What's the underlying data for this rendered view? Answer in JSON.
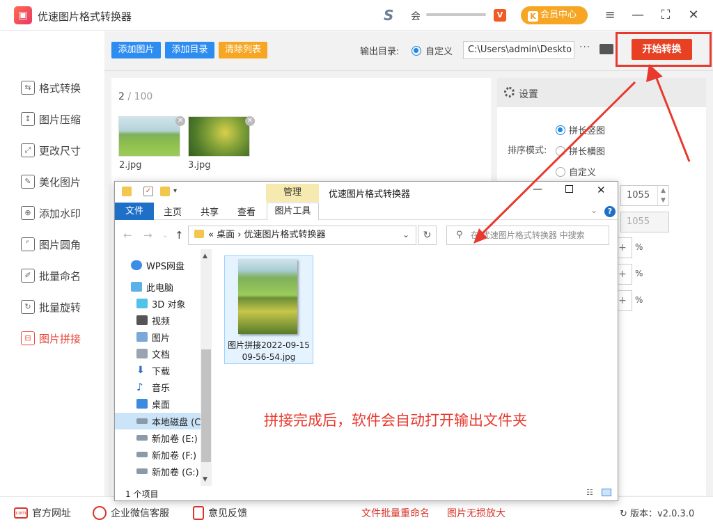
{
  "app": {
    "title": "优速图片格式转换器",
    "user_name": "会",
    "member_label": "会员中心",
    "member_k": "K",
    "vip_badge": "V"
  },
  "window_controls": {
    "menu": "≡",
    "minimize": "—",
    "maximize": "⛶",
    "close": "✕"
  },
  "sidebar": {
    "items": [
      {
        "label": "格式转换",
        "icon": "format-convert-icon"
      },
      {
        "label": "图片压缩",
        "icon": "compress-icon"
      },
      {
        "label": "更改尺寸",
        "icon": "resize-icon"
      },
      {
        "label": "美化图片",
        "icon": "beautify-icon"
      },
      {
        "label": "添加水印",
        "icon": "watermark-icon"
      },
      {
        "label": "图片圆角",
        "icon": "round-corner-icon"
      },
      {
        "label": "批量命名",
        "icon": "rename-icon"
      },
      {
        "label": "批量旋转",
        "icon": "rotate-icon"
      },
      {
        "label": "图片拼接",
        "icon": "stitch-icon",
        "active": true
      }
    ]
  },
  "toolbar": {
    "add_image": "添加图片",
    "add_folder": "添加目录",
    "clear_list": "清除列表",
    "output_label": "输出目录:",
    "custom_label": "自定义",
    "output_path": "C:\\Users\\admin\\Deskto",
    "more": "···",
    "start": "开始转换"
  },
  "images": {
    "count": "2",
    "total": "/ 100",
    "files": [
      "2.jpg",
      "3.jpg"
    ]
  },
  "settings": {
    "title": "设置",
    "sort_label": "排序模式:",
    "options": [
      "拼长竖图",
      "拼长横图",
      "自定义"
    ],
    "width_value": "1055",
    "height_value": "1055",
    "plus": "+",
    "percent": "%"
  },
  "explorer": {
    "manage_tab": "管理",
    "title": "优速图片格式转换器",
    "tabs": [
      "文件",
      "主页",
      "共享",
      "查看",
      "图片工具"
    ],
    "address": "«  桌面  ›  优速图片格式转换器",
    "search_placeholder": "在 优速图片格式转换器 中搜索",
    "tree": [
      "WPS网盘",
      "此电脑",
      "3D 对象",
      "视频",
      "图片",
      "文档",
      "下载",
      "音乐",
      "桌面",
      "本地磁盘 (C:)",
      "新加卷 (E:)",
      "新加卷 (F:)",
      "新加卷 (G:)"
    ],
    "file_name": "图片拼接2022-09-15 09-56-54.jpg",
    "status": "1 个项目"
  },
  "annotation": "拼接完成后，软件会自动打开输出文件夹",
  "footer": {
    "website": "官方网址",
    "wechat": "企业微信客服",
    "feedback": "意见反馈",
    "link1": "文件批量重命名",
    "link2": "图片无损放大",
    "version": "版本：v2.0.3.0"
  },
  "colors": {
    "accent_red": "#e8392e",
    "blue_button": "#2d8cf0",
    "orange_button": "#f6a623"
  }
}
